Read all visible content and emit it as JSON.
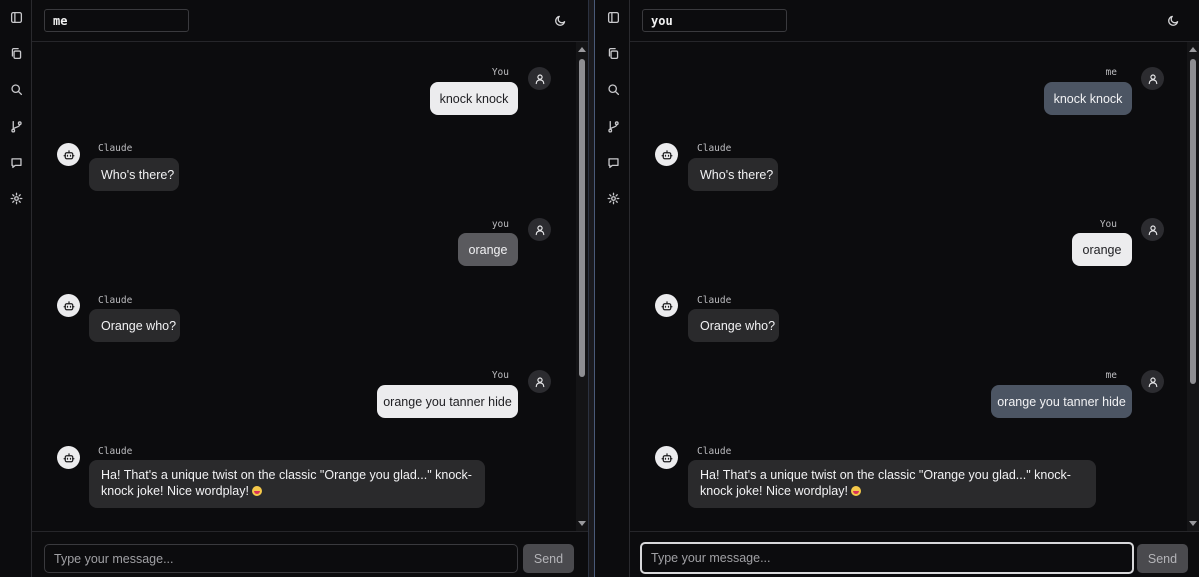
{
  "left": {
    "conversation_name": "me",
    "messages": [
      {
        "sender": "You",
        "text": "knock knock"
      },
      {
        "sender": "Claude",
        "text": "Who's there?"
      },
      {
        "sender": "you",
        "text": "orange"
      },
      {
        "sender": "Claude",
        "text": "Orange who?"
      },
      {
        "sender": "You",
        "text": "orange you tanner hide"
      },
      {
        "sender": "Claude",
        "text": "Ha! That's a unique twist on the classic \"Orange you glad...\" knock-knock joke! Nice wordplay!"
      }
    ],
    "input_placeholder": "Type your message...",
    "send_label": "Send"
  },
  "right": {
    "conversation_name": "you",
    "messages": [
      {
        "sender": "me",
        "text": "knock knock"
      },
      {
        "sender": "Claude",
        "text": "Who's there?"
      },
      {
        "sender": "You",
        "text": "orange"
      },
      {
        "sender": "Claude",
        "text": "Orange who?"
      },
      {
        "sender": "me",
        "text": "orange you tanner hide"
      },
      {
        "sender": "Claude",
        "text": "Ha! That's a unique twist on the classic \"Orange you glad...\" knock-knock joke! Nice wordplay!"
      }
    ],
    "input_placeholder": "Type your message...",
    "send_label": "Send"
  },
  "sidebar_icons": [
    "sidebar-toggle-icon",
    "files-icon",
    "search-icon",
    "branch-icon",
    "chat-icon",
    "settings-icon"
  ],
  "emoji": "tongue-out-face"
}
